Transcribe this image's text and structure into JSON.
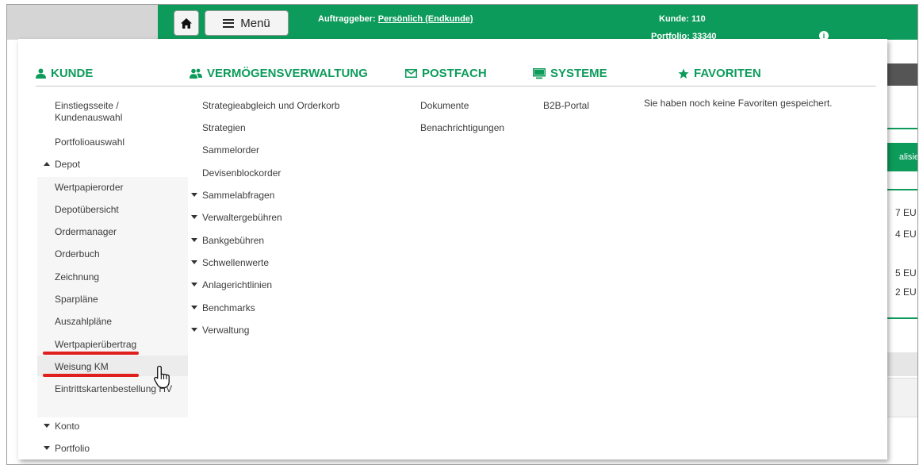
{
  "topbar": {
    "menu_label": "Menü",
    "auftraggeber_label": "Auftraggeber:",
    "auftraggeber_value": "Persönlich (Endkunde)",
    "kunde_label": "Kunde:",
    "kunde_value": "110",
    "portfolio_label": "Portfolio:",
    "portfolio_value": "33340"
  },
  "background": {
    "button_fragment": "alisie",
    "value_fragments": [
      "7 EU",
      "4 EU",
      "5 EU",
      "2 EU"
    ]
  },
  "colors": {
    "brand_green": "#0d9b5b",
    "highlight_red": "#e01e1e"
  },
  "icons": {
    "home": "home-icon",
    "menu": "hamburger-icon",
    "kunde": "user-icon",
    "vermoegen": "users-icon",
    "postfach": "envelope-icon",
    "systeme": "monitor-icon",
    "favoriten": "star-icon",
    "info": "info-icon",
    "cursor": "hand-pointer-icon"
  },
  "menu": {
    "headers": {
      "kunde": "KUNDE",
      "vermoegen": "VERMÖGENSVERWALTUNG",
      "postfach": "POSTFACH",
      "systeme": "SYSTEME",
      "favoriten": "FAVORITEN"
    },
    "kunde": {
      "einstieg": "Einstiegsseite / Kundenauswahl",
      "portfolioauswahl": "Portfolioauswahl",
      "depot": "Depot",
      "depot_items": [
        "Wertpapierorder",
        "Depotübersicht",
        "Ordermanager",
        "Orderbuch",
        "Zeichnung",
        "Sparpläne",
        "Auszahlpläne",
        "Wertpapierübertrag",
        "Weisung KM",
        "Eintrittskartenbestellung HV"
      ],
      "konto": "Konto",
      "portfolio": "Portfolio"
    },
    "vermoegen": {
      "links": [
        "Strategieabgleich und Orderkorb",
        "Strategien",
        "Sammelorder",
        "Devisenblockorder"
      ],
      "groups": [
        "Sammelabfragen",
        "Verwaltergebühren",
        "Bankgebühren",
        "Schwellenwerte",
        "Anlagerichtlinien",
        "Benchmarks",
        "Verwaltung"
      ]
    },
    "postfach": [
      "Dokumente",
      "Benachrichtigungen"
    ],
    "systeme": [
      "B2B-Portal"
    ],
    "favoriten_empty": "Sie haben noch keine Favoriten gespeichert."
  }
}
